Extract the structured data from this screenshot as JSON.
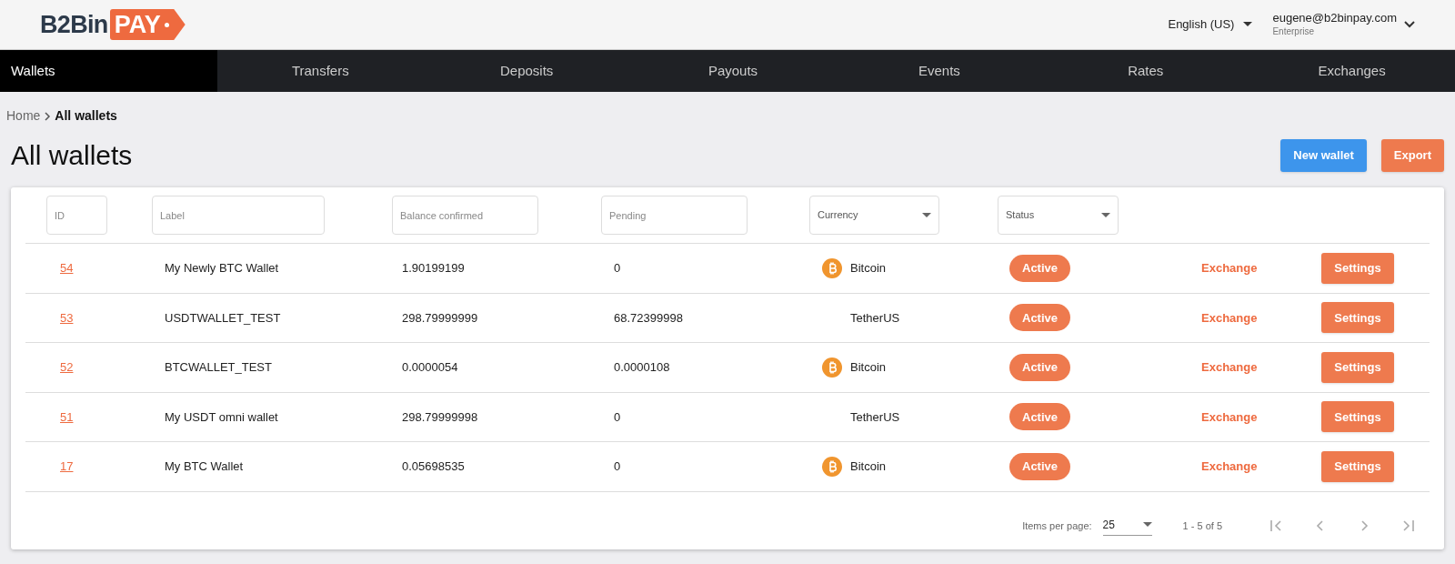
{
  "header": {
    "logo_left": "B2Bin",
    "logo_right": "PAY",
    "language": "English (US)",
    "user": {
      "email": "eugene@b2binpay.com",
      "plan": "Enterprise"
    }
  },
  "nav": [
    {
      "label": "Wallets",
      "selected": true
    },
    {
      "label": "Transfers",
      "selected": false
    },
    {
      "label": "Deposits",
      "selected": false
    },
    {
      "label": "Payouts",
      "selected": false
    },
    {
      "label": "Events",
      "selected": false
    },
    {
      "label": "Rates",
      "selected": false
    },
    {
      "label": "Exchanges",
      "selected": false
    }
  ],
  "breadcrumb": [
    "Home",
    "All wallets"
  ],
  "page_title": "All wallets",
  "actions": [
    {
      "label": "New wallet",
      "kind": "primary"
    },
    {
      "label": "Export",
      "kind": "secondary"
    }
  ],
  "filters": [
    {
      "placeholder": "ID",
      "kind": "text"
    },
    {
      "placeholder": "Label",
      "kind": "text"
    },
    {
      "placeholder": "Balance confirmed",
      "kind": "text"
    },
    {
      "placeholder": "Pending",
      "kind": "text"
    },
    {
      "placeholder": "Currency",
      "kind": "select"
    },
    {
      "placeholder": "Status",
      "kind": "select"
    }
  ],
  "rows": [
    {
      "id": "54",
      "label": "My Newly BTC Wallet",
      "balance": "1.90199199",
      "pending": "0",
      "currency": "Bitcoin",
      "coin_icon": true,
      "status": "Active",
      "exchange": "Exchange",
      "settings": "Settings"
    },
    {
      "id": "53",
      "label": "USDTWALLET_TEST",
      "balance": "298.79999999",
      "pending": "68.72399998",
      "currency": "TetherUS",
      "coin_icon": false,
      "status": "Active",
      "exchange": "Exchange",
      "settings": "Settings"
    },
    {
      "id": "52",
      "label": "BTCWALLET_TEST",
      "balance": "0.0000054",
      "pending": "0.0000108",
      "currency": "Bitcoin",
      "coin_icon": true,
      "status": "Active",
      "exchange": "Exchange",
      "settings": "Settings"
    },
    {
      "id": "51",
      "label": "My USDT omni wallet",
      "balance": "298.79999998",
      "pending": "0",
      "currency": "TetherUS",
      "coin_icon": false,
      "status": "Active",
      "exchange": "Exchange",
      "settings": "Settings"
    },
    {
      "id": "17",
      "label": "My BTC Wallet",
      "balance": "0.05698535",
      "pending": "0",
      "currency": "Bitcoin",
      "coin_icon": true,
      "status": "Active",
      "exchange": "Exchange",
      "settings": "Settings"
    }
  ],
  "paginator": {
    "label": "Items per page:",
    "page_size": "25",
    "range": "1 - 5 of 5"
  }
}
